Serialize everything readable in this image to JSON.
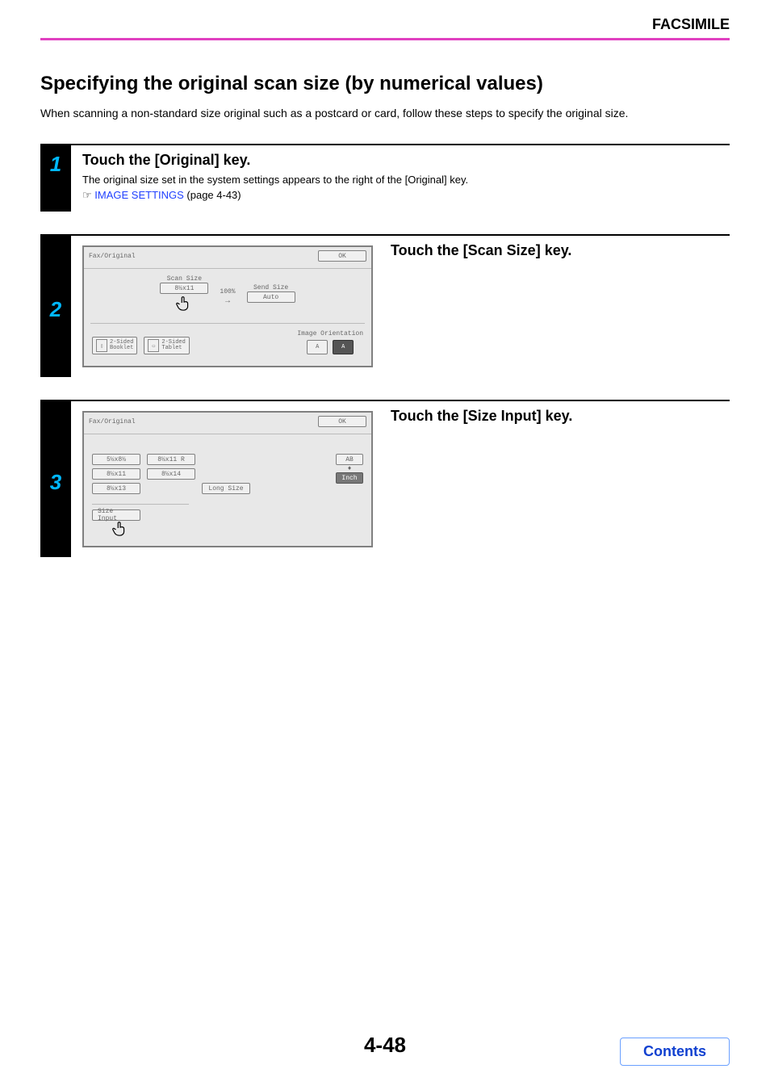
{
  "header": {
    "category": "FACSIMILE"
  },
  "title": "Specifying the original scan size (by numerical values)",
  "intro": "When scanning a non-standard size original such as a postcard or card, follow these steps to specify the original size.",
  "step1": {
    "num": "1",
    "heading": "Touch the [Original] key.",
    "text": "The original size set in the system settings appears to the right of the [Original] key.",
    "link_label": "IMAGE SETTINGS",
    "link_ref": " (page 4-43)"
  },
  "step2": {
    "num": "2",
    "heading": "Touch the [Scan Size] key.",
    "panel": {
      "title": "Fax/Original",
      "ok": "OK",
      "scan_size_label": "Scan Size",
      "scan_size_btn": "8½x11",
      "ratio": "100%",
      "send_size_label": "Send Size",
      "send_size_btn": "Auto",
      "image_orientation_label": "Image Orientation",
      "twosided_booklet_l1": "2-Sided",
      "twosided_booklet_l2": "Booklet",
      "twosided_tablet_l1": "2-Sided",
      "twosided_tablet_l2": "Tablet",
      "orient_a": "A",
      "orient_b": "A"
    }
  },
  "step3": {
    "num": "3",
    "heading": "Touch the [Size Input] key.",
    "panel": {
      "title": "Fax/Original",
      "ok": "OK",
      "sizes": {
        "a": "5½x8½",
        "b": "8½x11 R",
        "c": "8½x11",
        "d": "8½x14",
        "e": "8½x13",
        "long": "Long Size"
      },
      "unit_ab": "AB",
      "unit_inch": "Inch",
      "size_input": "Size Input"
    }
  },
  "page_number": "4-48",
  "contents": "Contents"
}
